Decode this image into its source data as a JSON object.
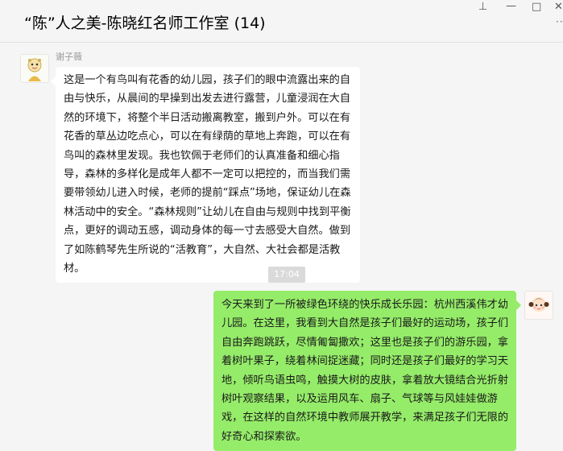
{
  "window": {
    "title": "“陈”人之美-陈晓红名师工作室 (14)",
    "controls": {
      "pin": "⊥",
      "minimize": "—",
      "maximize": "□",
      "close": "✕",
      "more": "···"
    }
  },
  "messages": [
    {
      "sender": "谢子薇",
      "side": "left",
      "text": "这是一个有鸟叫有花香的幼儿园，孩子们的眼中流露出来的自由与快乐，从晨间的早操到出发去进行露营，儿童浸润在大自然的环境下，将整个半日活动搬离教室，搬到户外。可以在有花香的草丛边吃点心，可以在有绿荫的草地上奔跑，可以在有鸟叫的森林里发现。我也钦佩于老师们的认真准备和细心指导，森林的多样化是成年人都不一定可以把控的，而当我们需要带领幼儿进入时候，老师的提前“踩点”场地，保证幼儿在森林活动中的安全。“森林规则”让幼儿在自由与规则中找到平衡点，更好的调动五感，调动身体的每一寸去感受大自然。做到了如陈鹤琴先生所说的“活教育”，大自然、大社会都是活教材。"
    },
    {
      "timestamp": "17:04"
    },
    {
      "side": "right",
      "text": "今天来到了一所被绿色环绕的快乐成长乐园：杭州西溪伟才幼儿园。在这里，我看到大自然是孩子们最好的运动场，孩子们自由奔跑跳跃，尽情匍匐撒欢；这里也是孩子们的游乐园，拿着树叶果子，绕着林间捉迷藏；同时还是孩子们最好的学习天地，倾听鸟语虫鸣，触摸大树的皮肤，拿着放大镜结合光折射树叶观察结果，以及运用风车、扇子、气球等与风娃娃做游戏，在这样的自然环境中教师展开教学，来满足孩子们无限的好奇心和探索欲。"
    }
  ],
  "colors": {
    "window_bg": "#f5f5f5",
    "incoming_bubble": "#ffffff",
    "outgoing_bubble": "#95ec69",
    "timestamp_bg": "#dadada"
  }
}
